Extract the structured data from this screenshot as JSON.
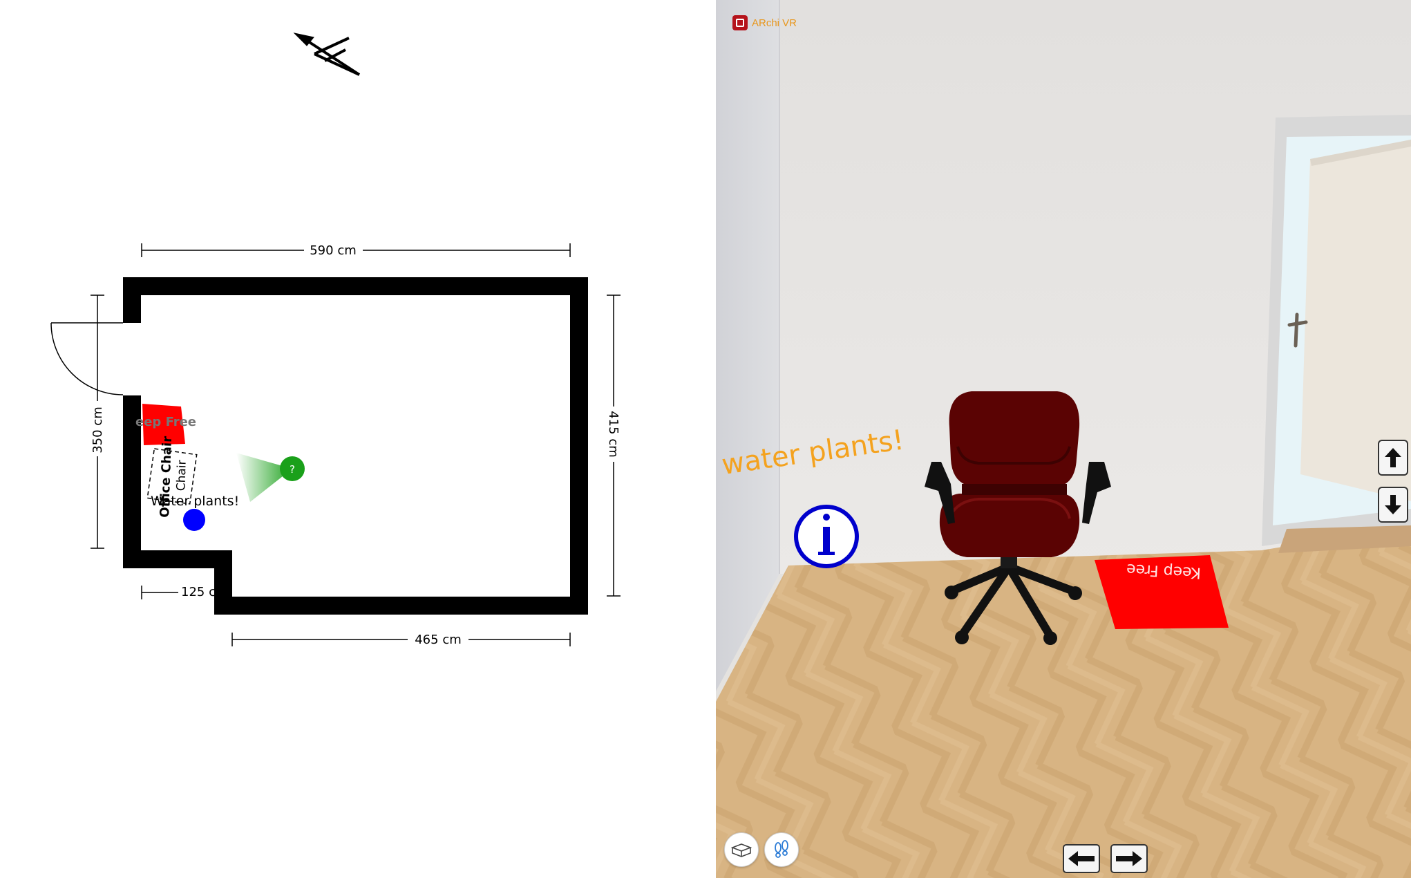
{
  "floor_plan": {
    "compass_icon": "north-arrow-icon",
    "dimensions": {
      "top": "590 cm",
      "right": "415 cm",
      "left": "350 cm",
      "bottom_step": "125 c",
      "bottom": "465 cm"
    },
    "markers": {
      "keep_free": "eep Free",
      "office_chair": "Office Chair",
      "chair": "Chair",
      "water_plants": "Water plants!",
      "camera_symbol": "?"
    },
    "colors": {
      "keep_free": "#ff0000",
      "position_dot": "#0000ff",
      "camera": "#1aa01a",
      "walls": "#000000"
    }
  },
  "view_3d": {
    "app_name": "ARchi VR",
    "water_plants_label": "water plants!",
    "keep_free_label": "Keep Free",
    "info_icon": "info-icon",
    "buttons": {
      "up": "arrow-up-icon",
      "down": "arrow-down-icon",
      "left": "arrow-left-icon",
      "right": "arrow-right-icon",
      "box_mode": "box-icon",
      "walk_mode": "footprints-icon"
    },
    "colors": {
      "label": "#f4a21e",
      "keep_free": "#ff0000",
      "info": "#0000cc",
      "chair": "#5a0303",
      "floor": "#d5b07e"
    }
  }
}
